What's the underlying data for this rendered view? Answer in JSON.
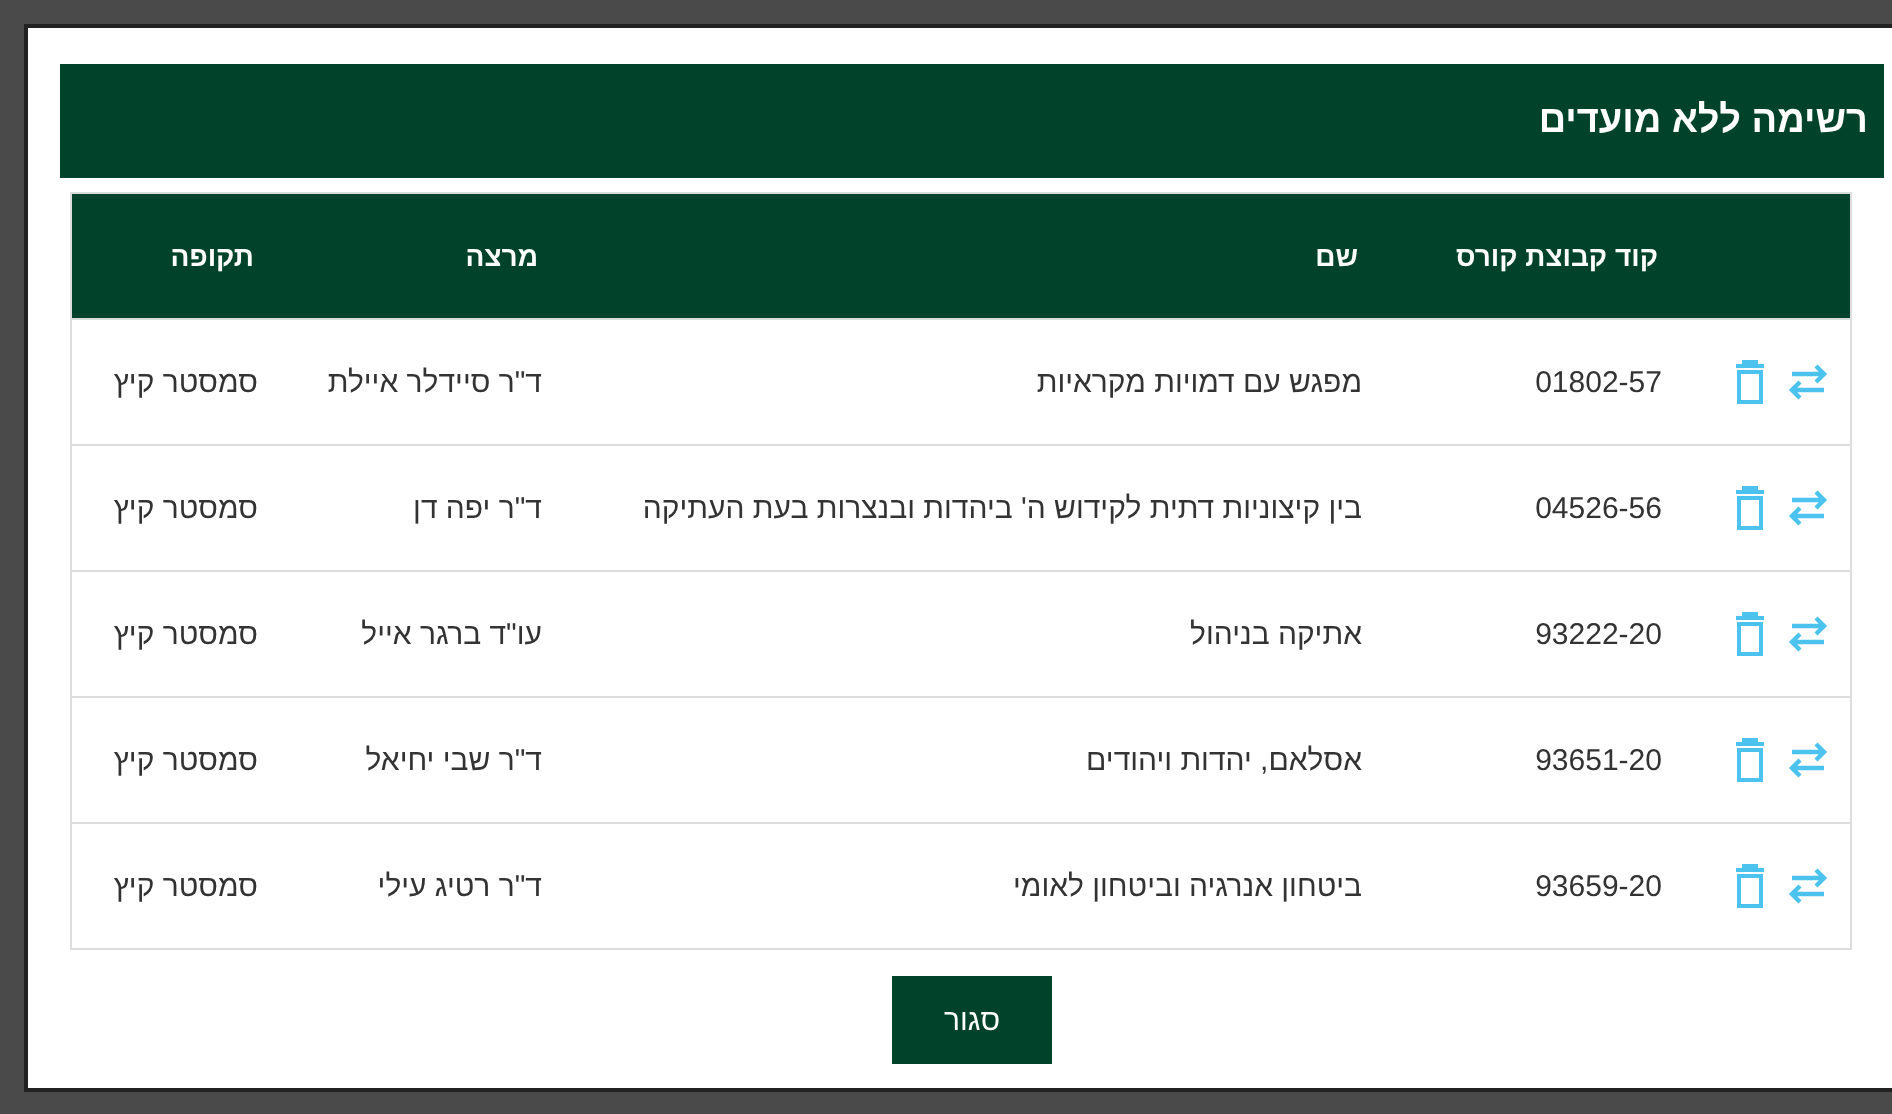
{
  "dialog": {
    "title": "רשימה ללא מועדים"
  },
  "table": {
    "columns": [
      "קוד קבוצת קורס",
      "שם",
      "מרצה",
      "תקופה"
    ],
    "rows": [
      {
        "code": "01802-57",
        "name": "מפגש עם דמויות מקראיות",
        "lecturer": "ד\"ר סיידלר איילת",
        "period": "סמסטר קיץ"
      },
      {
        "code": "04526-56",
        "name": "בין קיצוניות דתית לקידוש ה' ביהדות ובנצרות בעת העתיקה",
        "lecturer": "ד\"ר יפה דן",
        "period": "סמסטר קיץ"
      },
      {
        "code": "93222-20",
        "name": "אתיקה בניהול",
        "lecturer": "עו\"ד ברגר אייל",
        "period": "סמסטר קיץ"
      },
      {
        "code": "93651-20",
        "name": "אסלאם, יהדות ויהודים",
        "lecturer": "ד\"ר שבי יחיאל",
        "period": "סמסטר קיץ"
      },
      {
        "code": "93659-20",
        "name": "ביטחון אנרגיה וביטחון לאומי",
        "lecturer": "ד\"ר רטיג עילי",
        "period": "סמסטר קיץ"
      }
    ]
  },
  "buttons": [
    "סגור"
  ]
}
